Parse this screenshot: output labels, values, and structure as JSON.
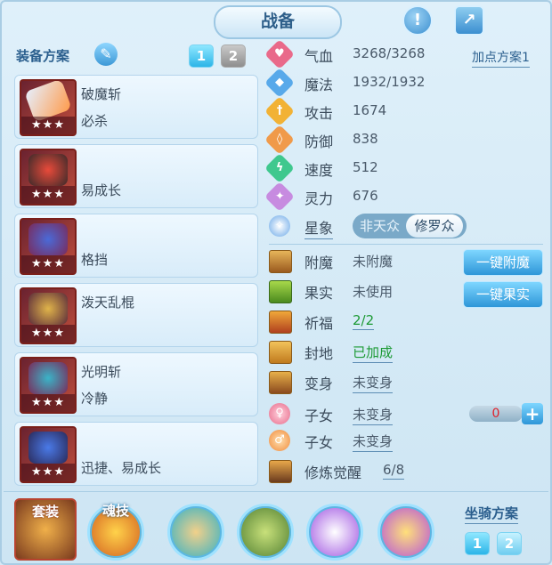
{
  "title": "战备",
  "left": {
    "section_title": "装备方案",
    "plan_tabs": [
      "1",
      "2"
    ],
    "equipment": [
      {
        "name": "破魔斩",
        "tag": "必杀",
        "stars": "★★★"
      },
      {
        "name": "",
        "tag": "易成长",
        "stars": "★★★"
      },
      {
        "name": "",
        "tag": "格挡",
        "stars": "★★★"
      },
      {
        "name": "泼天乱棍",
        "tag": "",
        "stars": "★★★"
      },
      {
        "name": "光明斩",
        "tag": "冷静",
        "stars": "★★★"
      },
      {
        "name": "",
        "tag": "迅捷、易成长",
        "stars": "★★★"
      }
    ]
  },
  "right": {
    "add_point_plan": "加点方案1",
    "stats": [
      {
        "label": "气血",
        "value": "3268/3268",
        "color": "#e96a8a",
        "icon": "heart-icon"
      },
      {
        "label": "魔法",
        "value": "1932/1932",
        "color": "#58a9ea",
        "icon": "mana-icon"
      },
      {
        "label": "攻击",
        "value": "1674",
        "color": "#f2b234",
        "icon": "sword-icon"
      },
      {
        "label": "防御",
        "value": "838",
        "color": "#f09a4a",
        "icon": "shield-icon"
      },
      {
        "label": "速度",
        "value": "512",
        "color": "#3fc88e",
        "icon": "speed-icon"
      },
      {
        "label": "灵力",
        "value": "676",
        "color": "#c78be0",
        "icon": "spirit-icon"
      }
    ],
    "star_sign": {
      "label": "星象",
      "options": [
        "非天众",
        "修罗众"
      ],
      "selected": "修罗众"
    },
    "attributes": [
      {
        "label": "附魔",
        "value": "未附魔",
        "button": "一键附魔"
      },
      {
        "label": "果实",
        "value": "未使用",
        "button": "一键果实"
      },
      {
        "label": "祈福",
        "value": "2/2",
        "button": ""
      },
      {
        "label": "封地",
        "value": "已加成",
        "button": ""
      },
      {
        "label": "变身",
        "value": "未变身",
        "button": ""
      }
    ],
    "children": [
      {
        "label": "子女",
        "value": "未变身"
      },
      {
        "label": "子女",
        "value": "未变身"
      }
    ],
    "cultivation": {
      "label": "修炼觉醒",
      "value": "6/8"
    },
    "counter_value": "0",
    "plus": "+"
  },
  "bottom": {
    "set_label": "套装",
    "soul_skill_label": "魂技",
    "mount_plan_label": "坐骑方案",
    "mount_tabs": [
      "1",
      "2"
    ]
  },
  "colors": {
    "accent": "#2cb5e8",
    "title_text": "#2e5f8a",
    "positive_text": "#1c9a34",
    "counter_text": "#e0202a"
  }
}
